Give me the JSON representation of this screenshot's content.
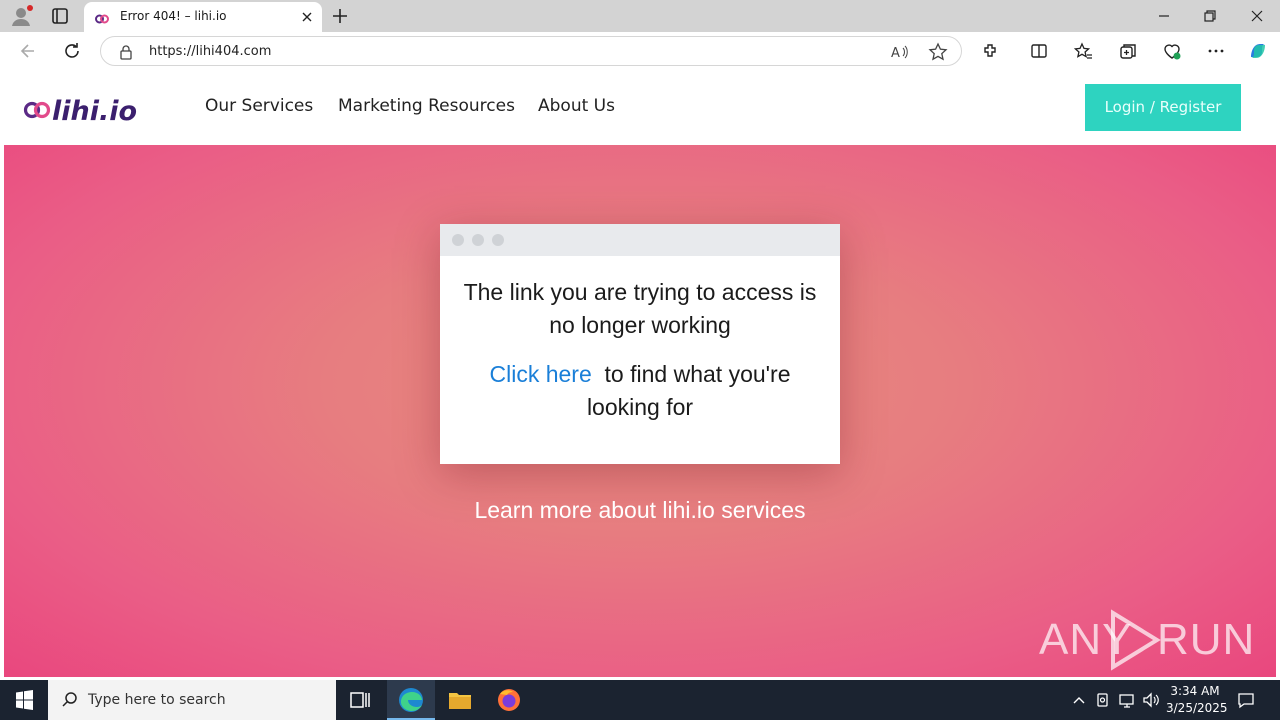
{
  "browser": {
    "tab_title": "Error 404! – lihi.io",
    "url": "https://lihi404.com"
  },
  "site": {
    "logo_text": "lihi.io",
    "nav": [
      "Our Services",
      "Marketing Resources",
      "About Us"
    ],
    "login_label": "Login / Register",
    "accent_color": "#2ed3c0",
    "hero_colors": [
      "#e88a7d",
      "#e9477e"
    ]
  },
  "card": {
    "message": "The link you are trying to access is no longer working",
    "link_text": "Click here",
    "cta_rest": "to find what you're looking for"
  },
  "learn_more": "Learn more about lihi.io services",
  "watermark": {
    "left": "ANY",
    "right": "RUN"
  },
  "taskbar": {
    "search_placeholder": "Type here to search",
    "time": "3:34 AM",
    "date": "3/25/2025"
  }
}
